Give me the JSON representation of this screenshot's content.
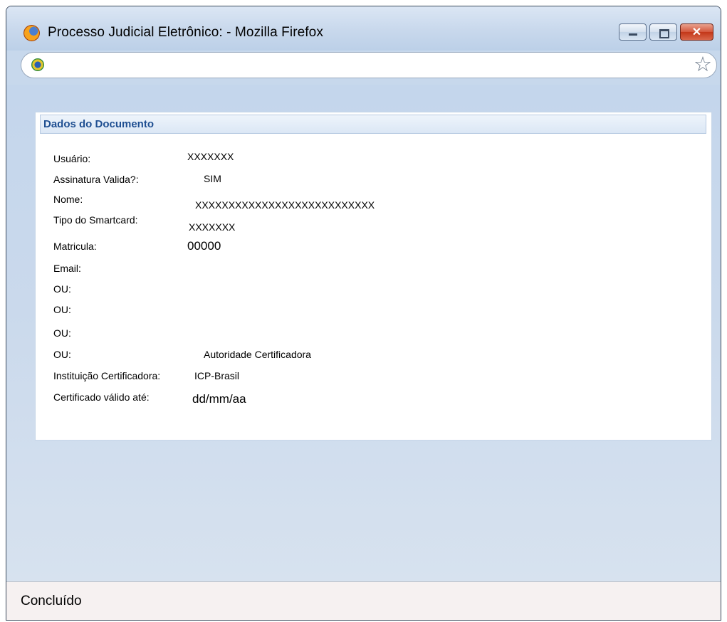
{
  "window": {
    "title": "Processo Judicial Eletrônico:  - Mozilla Firefox",
    "close_glyph": "✕",
    "star_glyph": "☆"
  },
  "panel": {
    "title": "Dados do Documento",
    "fields": {
      "usuario": {
        "label": "Usuário:",
        "value": "XXXXXXX"
      },
      "assinatura": {
        "label": "Assinatura Valida?:",
        "value": "SIM"
      },
      "nome": {
        "label": "Nome:",
        "value": "XXXXXXXXXXXXXXXXXXXXXXXXXXX"
      },
      "tipo": {
        "label": "Tipo do Smartcard:",
        "value": "XXXXXXX"
      },
      "matricula": {
        "label": "Matricula:",
        "value": "00000"
      },
      "email": {
        "label": "Email:",
        "value": ""
      },
      "ou1": {
        "label": "OU:",
        "value": ""
      },
      "ou2": {
        "label": "OU:",
        "value": ""
      },
      "ou3": {
        "label": "OU:",
        "value": ""
      },
      "ou4": {
        "label": "OU:",
        "value": "Autoridade Certificadora"
      },
      "instituicao": {
        "label": "Instituição Certificadora:",
        "value": "ICP-Brasil"
      },
      "validade": {
        "label": "Certificado válido até:",
        "value": "dd/mm/aa"
      }
    }
  },
  "status": {
    "text": "Concluído"
  },
  "icons": {
    "browser_logo": "firefox-icon",
    "site": "brasil-coat-of-arms-icon",
    "bookmark": "star-icon"
  },
  "colors": {
    "panel_header_text": "#1f4f91",
    "content_background": "#c7d8ec",
    "close_button": "#c33718"
  }
}
